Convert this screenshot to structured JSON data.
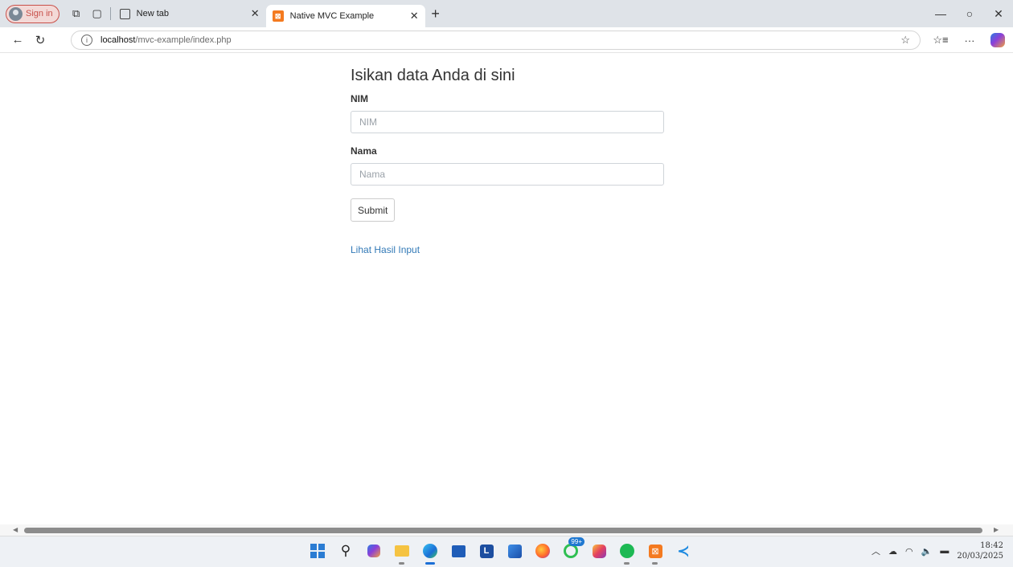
{
  "browser": {
    "signin_label": "Sign in",
    "tabs": [
      {
        "title": "New tab",
        "active": false
      },
      {
        "title": "Native MVC Example",
        "active": true
      }
    ],
    "url_host": "localhost",
    "url_path": "/mvc-example/index.php"
  },
  "form": {
    "heading": "Isikan data Anda di sini",
    "nim_label": "NIM",
    "nim_placeholder": "NIM",
    "nim_value": "",
    "nama_label": "Nama",
    "nama_placeholder": "Nama",
    "nama_value": "",
    "submit_label": "Submit",
    "result_link": "Lihat Hasil Input"
  },
  "taskbar": {
    "apps": [
      "start-icon",
      "search-icon",
      "copilot-icon",
      "file-explorer-icon",
      "edge-icon",
      "store-icon",
      "l-app-icon",
      "photos-icon",
      "firefox-icon",
      "whatsapp-icon",
      "instagram-icon",
      "spotify-icon",
      "xampp-icon",
      "vscode-icon"
    ],
    "badge": "99+",
    "time": "18:42",
    "date": "20/03/2025"
  }
}
